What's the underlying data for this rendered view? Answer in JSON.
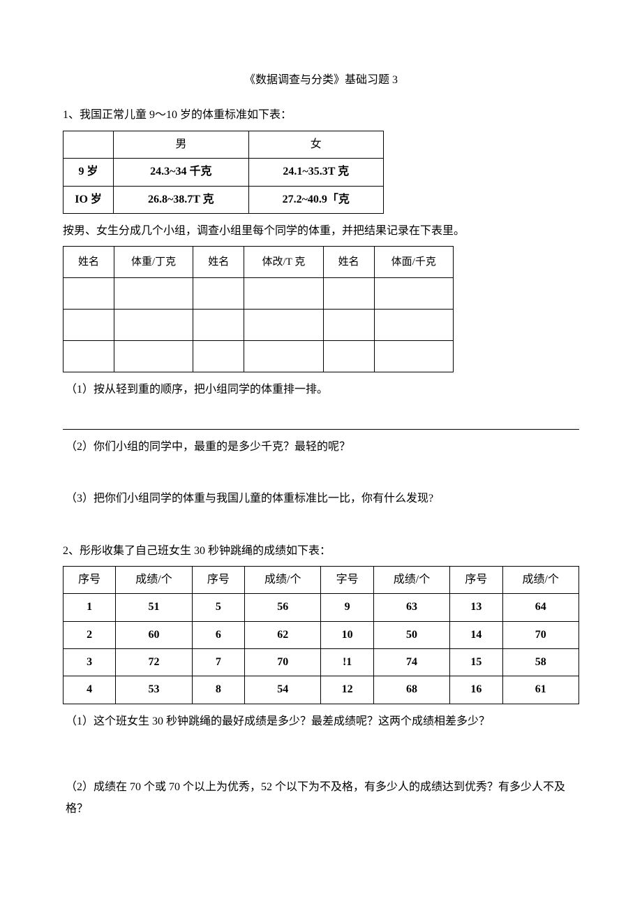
{
  "title": "《数据调查与分类》基础习题 3",
  "q1": {
    "intro": "1、我国正常儿童 9～10 岁的体重标准如下表：",
    "table1": {
      "h1": "男",
      "h2": "女",
      "r1c0": "9 岁",
      "r1c1": "24.3~34 千克",
      "r1c2": "24.1~35.3T 克",
      "r2c0": "IO 岁",
      "r2c1": "26.8~38.7T 克",
      "r2c2": "27.2~40.9「克"
    },
    "instr": "按男、女生分成几个小组，调查小组里每个同学的体重，并把结果记录在下表里。",
    "table2": {
      "h1": "姓名",
      "h2": "体重/丁克",
      "h3": "姓名",
      "h4": "体改/T 克",
      "h5": "姓名",
      "h6": "体面/千克"
    },
    "p1": "（1）按从轻到重的顺序，把小组同学的体重排一排。",
    "p2": "（2）你们小组的同学中，最重的是多少千克？最轻的呢？",
    "p3": "（3）把你们小组同学的体重与我国儿童的体重标准比一比，你有什么发现?"
  },
  "q2": {
    "intro": "2、彤彤收集了自己班女生 30 秒钟跳绳的成绩如下表：",
    "headers": [
      "序号",
      "成绩/个",
      "序号",
      "成绩/个",
      "字号",
      "成绩/个",
      "序号",
      "成绩/个"
    ],
    "rows": [
      [
        "1",
        "51",
        "5",
        "56",
        "9",
        "63",
        "13",
        "64"
      ],
      [
        "2",
        "60",
        "6",
        "62",
        "10",
        "50",
        "14",
        "70"
      ],
      [
        "3",
        "72",
        "7",
        "70",
        "!1",
        "74",
        "15",
        "58"
      ],
      [
        "4",
        "53",
        "8",
        "54",
        "12",
        "68",
        "16",
        "61"
      ]
    ],
    "p1": "（1）这个班女生 30 秒钟跳绳的最好成绩是多少？最差成绩呢？这两个成绩相差多少？",
    "p2": "（2）成绩在 70 个或 70 个以上为优秀，52 个以下为不及格，有多少人的成绩达到优秀？有多少人不及格？"
  }
}
